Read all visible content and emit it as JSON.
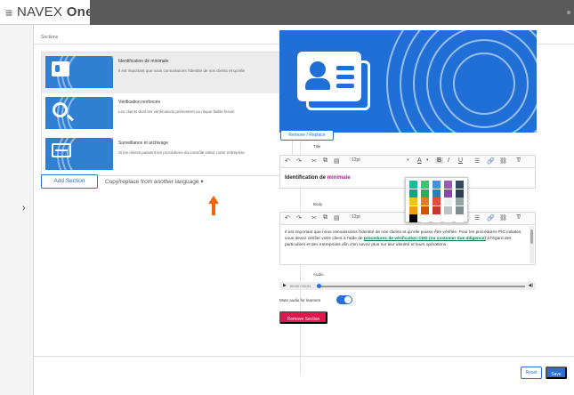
{
  "header": {
    "brand_prefix": "NAVEX",
    "brand_suffix": "One",
    "brand_mark": "®"
  },
  "sections_label": "Sections",
  "sections": [
    {
      "title": "Identification de minimale",
      "description": "Il est important que nous connaissions l'identité de nos clients et qu'elle",
      "icon": "id-card-icon"
    },
    {
      "title": "Vérification renforcée",
      "description": "Les clients dont les vérifications présentent un risque faible feront",
      "icon": "magnifier-icon"
    },
    {
      "title": "Surveillance et archivage",
      "description": "Si les clients passent les procédures du contrôle initial, notre entreprise",
      "icon": "monitor-pulse-icon"
    }
  ],
  "add_section_label": "Add Section",
  "copy_replace_label": "Copy/replace from another language",
  "remove_replace_label": "Remove / Replace",
  "title_label": "Title",
  "body_label": "Body",
  "audio_label": "Audio",
  "font_size": "12pt",
  "title_text_main": "Identification de ",
  "title_text_highlight": "minimale",
  "body_text_1": "Il est important que nous connaissions l'identité de nos clients et qu'elle puisse être vérifiée. Pour les procédures PIC initiales, vous devez vérifier votre client à l'aide de ",
  "body_text_link": "procédures de vérification CDD (ou customer due diligence)",
  "body_text_2": " à l'égard des particuliers et des entreprises afin d'en savoir plus sur leur identité et leurs opérations.",
  "audio_time": "00:00 / 00:01",
  "mute_label": "Mute audio for learners",
  "mute_enabled": true,
  "remove_section_label": "Remove Section",
  "reset_label": "Reset",
  "save_label": "Save",
  "colors": {
    "accent": "#2a6fd6",
    "danger": "#e0174f",
    "hero": "#1f6fd6"
  },
  "palette_colors": [
    "#1abc9c",
    "#2ecc71",
    "#3498db",
    "#9b59b6",
    "#34495e",
    "#16a085",
    "#27ae60",
    "#2980b9",
    "#8e44ad",
    "#2c3e50",
    "#f1c40f",
    "#e67e22",
    "#e74c3c",
    "#ecf0f1",
    "#95a5a6",
    "#f39c12",
    "#d35400",
    "#c0392b",
    "#bdc3c7",
    "#7f8c8d",
    "#000000",
    "#ffffff",
    "#ffffff",
    "#ffffff",
    "#ffffff"
  ]
}
